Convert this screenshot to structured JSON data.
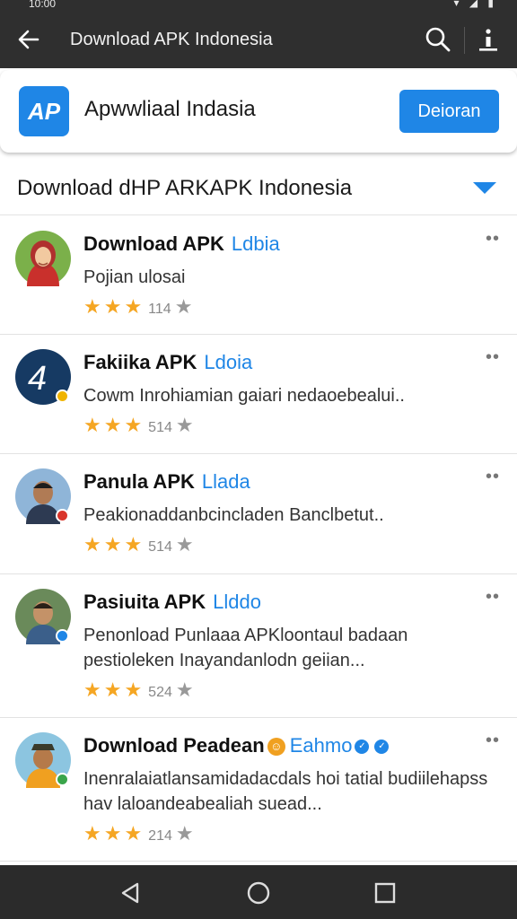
{
  "status_bar": {
    "time": "10:00",
    "icons": "▾ ◢ ▮"
  },
  "app_bar": {
    "title": "Download APK Indonesia"
  },
  "app_card": {
    "logo_text": "AP",
    "name": "Apwwliaal Indasia",
    "button_label": "Deioran"
  },
  "section": {
    "title": "Download dHP ARKAPK Indonesia"
  },
  "items": [
    {
      "name": "Download APK",
      "tag": "Ldbia",
      "desc": "Pojian ulosai",
      "stars": "★★★",
      "count": "114",
      "overflow": "••"
    },
    {
      "name": "Fakiika APK",
      "tag": "Ldoia",
      "desc": "Cowm Inrohiamian gaiari nedaoebealui..",
      "stars": "★★★",
      "count": "514",
      "overflow": "••"
    },
    {
      "name": "Panula APK",
      "tag": "Llada",
      "desc": "Peakionaddanbcincladen Banclbetut..",
      "stars": "★★★",
      "count": "514",
      "overflow": "••"
    },
    {
      "name": "Pasiuita APK",
      "tag": "Llddo",
      "desc": "Penonload Punlaaa APKloontaul badaan pestioleken Inayandanlodn geiian...",
      "stars": "★★★",
      "count": "524",
      "overflow": "••"
    },
    {
      "name": "Download Peadean",
      "tag": "Eahmo",
      "desc": "Inenralaiatlansamidadacdals hoi tatial budiilehapss hav laloandeabealiah suead...",
      "stars": "★★★",
      "count": "214",
      "overflow": "••"
    }
  ],
  "colors": {
    "accent": "#1f86e6",
    "star": "#f5a623",
    "appbar": "#2f2f2f"
  },
  "icons": [
    "back-arrow-icon",
    "search-icon",
    "more-vert-icon",
    "dropdown-caret-icon",
    "back-nav-icon",
    "home-nav-icon",
    "recents-nav-icon"
  ]
}
